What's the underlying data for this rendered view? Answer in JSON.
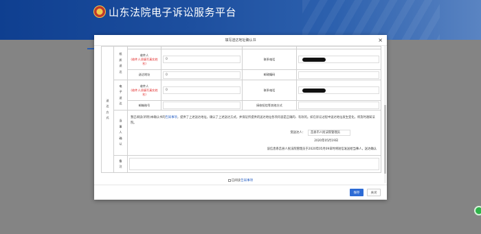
{
  "site": {
    "title": "山东法院电子诉讼服务平台"
  },
  "modal": {
    "title": "填写送达地址确认书",
    "close_icon": "×",
    "method_label": "送\n达\n方\n式",
    "paper": {
      "group_label": "纸\n质\n送\n达",
      "recipient_label": "收件人",
      "recipient_hint": "(收件人须填写真实姓名)",
      "recipient_value": "0",
      "phone_label": "联系电话",
      "address_label": "送达地址",
      "address_value": "0",
      "postcode_label": "邮政编码",
      "postcode_value": ""
    },
    "electronic": {
      "group_label": "电\n子\n送\n达",
      "recipient_label": "收件人",
      "recipient_hint": "(收件人须填写真实姓名)",
      "recipient_value": "0",
      "phone_label": "联系电话",
      "email_label": "邮箱账号",
      "email_value": "",
      "other_label": "接收短信等其他方式",
      "other_value": ""
    },
    "confirm": {
      "label": "当\n事\n人\n确\n认",
      "text_before": "我已阅读(听明)本确认书的",
      "link": "告知事项",
      "text_after": "，提供了上述送达地址，确认了上述送达方式，并保证所提供的送达地址各项内容是正确的、有效的。如在诉讼过程中送达地址发生变化，将及时通知法院。",
      "signer_label": "受送达人：",
      "signer_value": "莒县市人民法院管理员",
      "date": "2020年05月19日",
      "sent_note": "该信息系莒县人民法院管理员于2020年05月09日时将短信发送给当事人，送达确认"
    },
    "remark_label": "备\n注",
    "agree_text": "已阅读",
    "agree_link": "告知事项",
    "save_label": "保存",
    "close_label": "关闭"
  }
}
